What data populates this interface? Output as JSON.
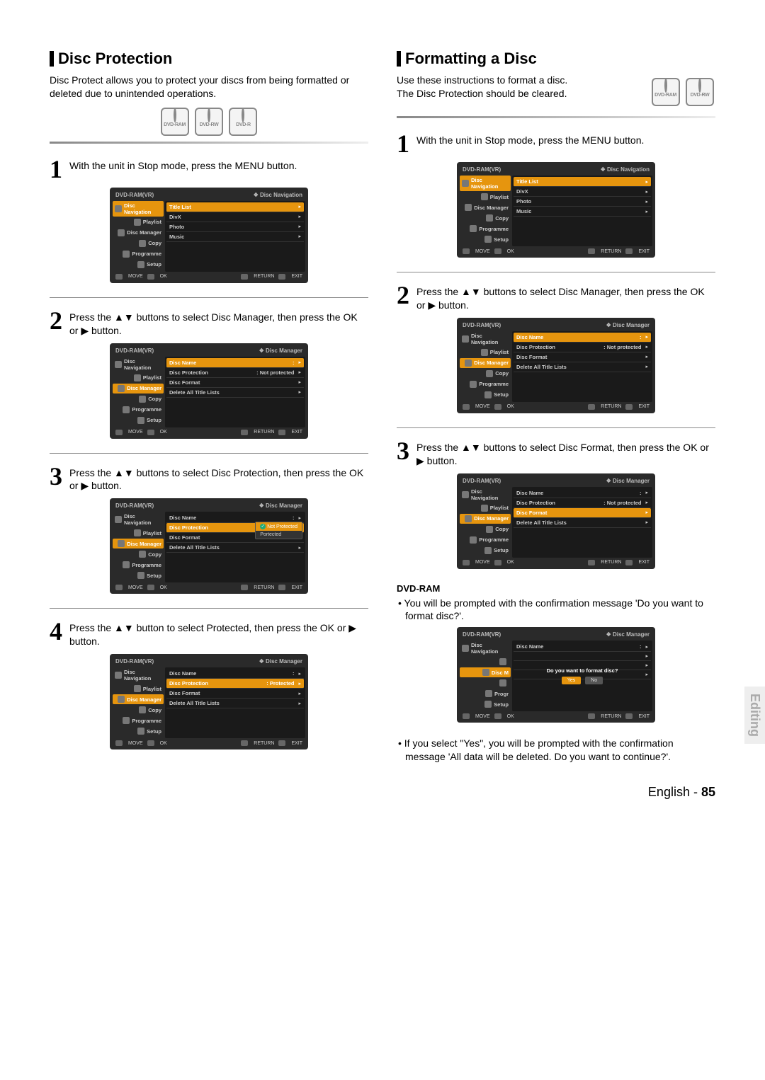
{
  "left": {
    "title": "Disc Protection",
    "intro": "Disc Protect allows you to protect your discs from being formatted or deleted due to unintended operations.",
    "disc_labels": [
      "DVD-RAM",
      "DVD-RW",
      "DVD-R"
    ],
    "step1": "With the unit in Stop mode, press the MENU button.",
    "step2": "Press the ▲▼ buttons to select Disc Manager, then press the OK or ▶ button.",
    "step3": "Press the ▲▼ buttons to select Disc Protection, then press the OK or ▶ button.",
    "step4": "Press the ▲▼ button to select Protected, then press the OK or ▶ button."
  },
  "right": {
    "title": "Formatting a Disc",
    "intro": "Use these instructions to format a disc.\nThe Disc Protection should be cleared.",
    "disc_labels": [
      "DVD-RAM",
      "DVD-RW"
    ],
    "step1": "With the unit in Stop mode, press the MENU button.",
    "step2": "Press the ▲▼ buttons to select Disc Manager, then press the OK or ▶ button.",
    "step3": "Press the ▲▼ buttons to select Disc Format, then press the OK or ▶ button.",
    "sub_heading": "DVD-RAM",
    "bullet1": "You will be prompted with the confirmation message 'Do you want to format disc?'.",
    "bullet2": "If you select \"Yes\", you will be prompted with the confirmation message 'All data will be deleted. Do you want to continue?'."
  },
  "osd": {
    "header_title": "DVD-RAM(VR)",
    "breadcrumb_nav": "Disc Navigation",
    "breadcrumb_mgr": "Disc Manager",
    "sidebar": [
      "Disc Navigation",
      "Playlist",
      "Disc Manager",
      "Copy",
      "Programme",
      "Setup"
    ],
    "nav_rows": [
      "Title List",
      "DivX",
      "Photo",
      "Music"
    ],
    "mgr_rows": {
      "name": "Disc Name",
      "name_val": ":",
      "protection": "Disc Protection",
      "prot_val_notprot": ": Not protected",
      "prot_val_prot": ": Protected",
      "format": "Disc Format",
      "delete": "Delete All Title Lists"
    },
    "dropdown": {
      "opt1": "Not Protected",
      "opt2": "Portected"
    },
    "dialog": {
      "text": "Do you want to format disc?",
      "yes": "Yes",
      "no": "No"
    },
    "footer": {
      "move": "MOVE",
      "ok": "OK",
      "return": "RETURN",
      "exit": "EXIT"
    }
  },
  "side_tab": "Editing",
  "footer_lang": "English - ",
  "footer_page": "85"
}
